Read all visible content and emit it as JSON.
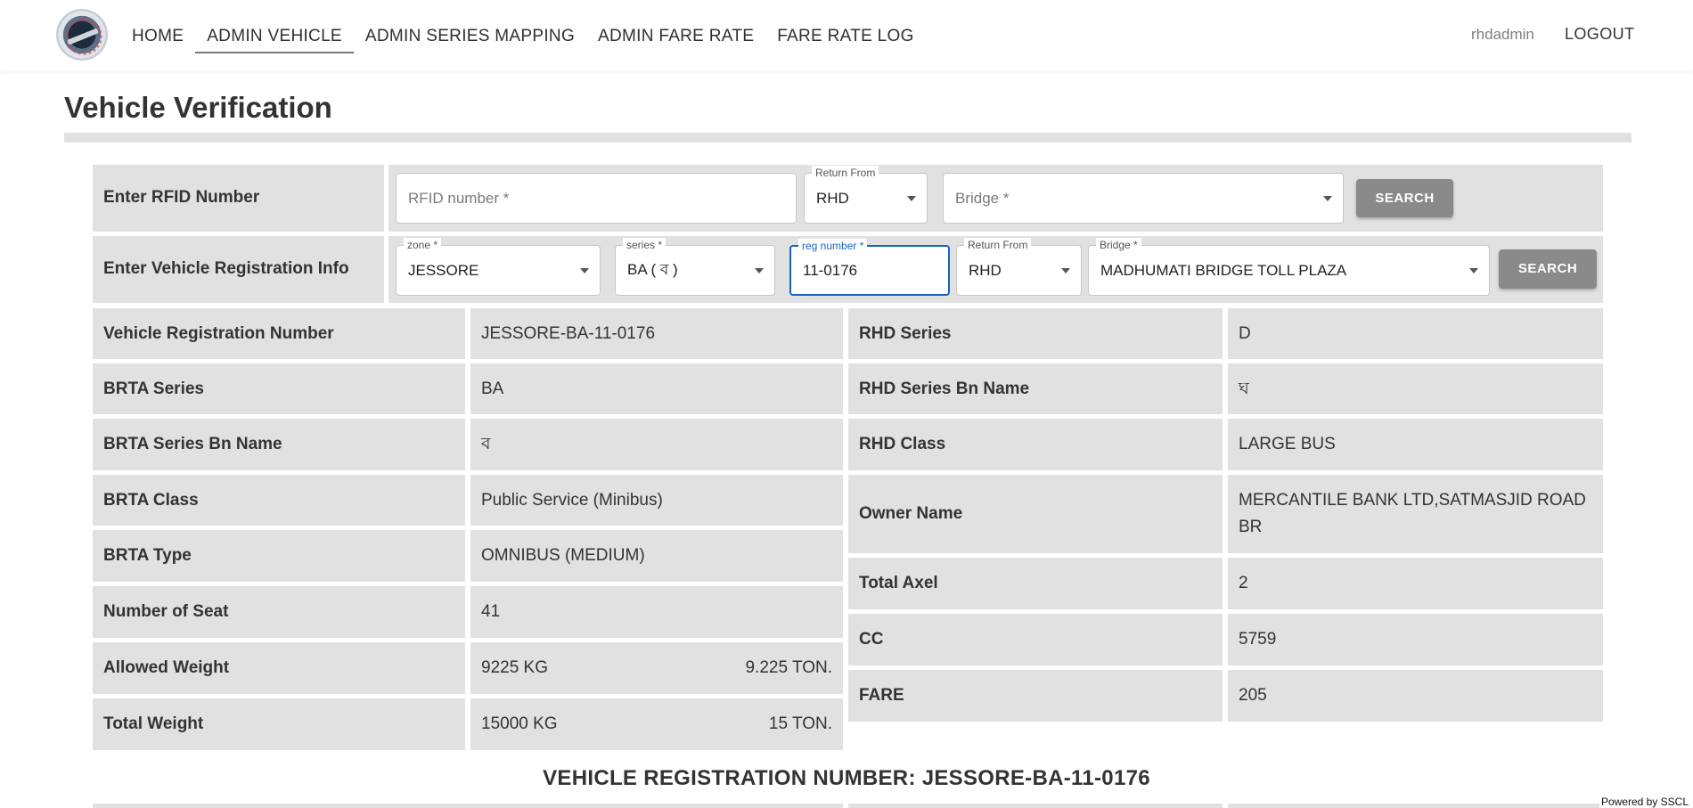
{
  "nav": {
    "items": [
      {
        "label": "HOME"
      },
      {
        "label": "ADMIN VEHICLE"
      },
      {
        "label": "ADMIN SERIES MAPPING"
      },
      {
        "label": "ADMIN FARE RATE"
      },
      {
        "label": "FARE RATE LOG"
      }
    ],
    "user": "rhdadmin",
    "logout": "LOGOUT"
  },
  "page": {
    "title": "Vehicle Verification"
  },
  "rfid_row": {
    "label": "Enter RFID Number",
    "rfid_placeholder": "RFID number *",
    "return_from_legend": "Return From",
    "return_from_value": "RHD",
    "bridge_placeholder": "Bridge *",
    "search": "SEARCH"
  },
  "reg_row": {
    "label": "Enter Vehicle Registration Info",
    "zone_legend": "zone *",
    "zone_value": "JESSORE",
    "series_legend": "series *",
    "series_value": "BA ( ব )",
    "reg_legend": "reg number *",
    "reg_value": "11-0176",
    "return_from_legend": "Return From",
    "return_from_value": "RHD",
    "bridge_legend": "Bridge *",
    "bridge_value": "MADHUMATI BRIDGE TOLL PLAZA",
    "search": "SEARCH"
  },
  "info_left": [
    {
      "label": "Vehicle Registration Number",
      "value": "JESSORE-BA-11-0176"
    },
    {
      "label": "BRTA Series",
      "value": "BA"
    },
    {
      "label": "BRTA Series Bn Name",
      "value": "ব"
    },
    {
      "label": "BRTA Class",
      "value": "Public Service (Minibus)"
    },
    {
      "label": "BRTA Type",
      "value": "OMNIBUS (MEDIUM)"
    },
    {
      "label": "Number of Seat",
      "value": "41"
    },
    {
      "label": "Allowed Weight",
      "value": "9225 KG",
      "value2": "9.225 TON."
    },
    {
      "label": "Total Weight",
      "value": "15000 KG",
      "value2": "15 TON."
    }
  ],
  "info_right": [
    {
      "label": "RHD Series",
      "value": "D"
    },
    {
      "label": "RHD Series Bn Name",
      "value": "ঘ"
    },
    {
      "label": "RHD Class",
      "value": "LARGE BUS"
    },
    {
      "label": "Owner Name",
      "value": "MERCANTILE BANK LTD,SATMASJID ROAD BR"
    },
    {
      "label": "Total Axel",
      "value": "2"
    },
    {
      "label": "CC",
      "value": "5759"
    },
    {
      "label": "FARE",
      "value": "205"
    }
  ],
  "section_heading": "VEHICLE REGISTRATION NUMBER: JESSORE-BA-11-0176",
  "footer": {
    "powered": "Powered by SSCL"
  }
}
